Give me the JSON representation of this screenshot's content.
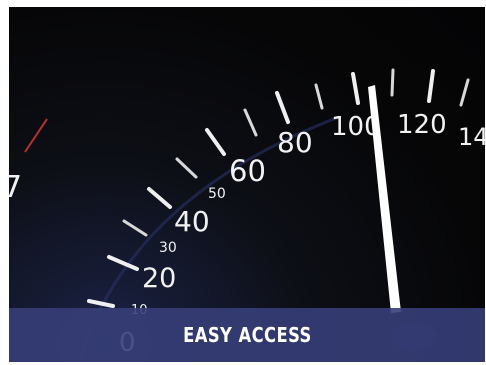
{
  "caption": {
    "text": "EASY ACCESS"
  },
  "gauge": {
    "major_labels": [
      "0",
      "20",
      "40",
      "60",
      "80",
      "100",
      "120",
      "14"
    ],
    "minor_labels": [
      "10",
      "30",
      "50"
    ],
    "partial_digit": "7"
  },
  "colors": {
    "caption_bg": "#363e78",
    "dial_bg": "#060607",
    "needle": "#ffffff",
    "accent_red": "#c0392b"
  }
}
